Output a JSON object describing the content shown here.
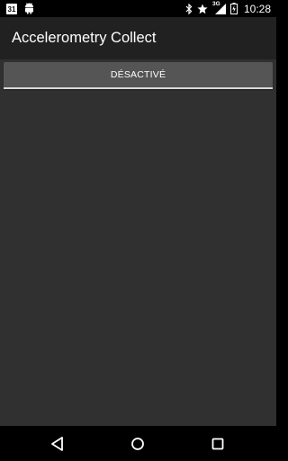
{
  "status_bar": {
    "time": "10:28",
    "calendar_day": "31",
    "network_type": "3G",
    "icons": [
      "calendar-icon",
      "android-icon",
      "bluetooth-icon",
      "star-icon",
      "signal-icon",
      "battery-icon"
    ]
  },
  "app": {
    "title": "Accelerometry Collect"
  },
  "toggle": {
    "label": "DÉSACTIVÉ"
  },
  "nav_bar": {
    "icons": [
      "back-icon",
      "home-icon",
      "recents-icon"
    ]
  },
  "colors": {
    "background": "#303030",
    "action_bar": "#212121",
    "button": "#555555",
    "indicator_off": "#d8d8d8"
  }
}
